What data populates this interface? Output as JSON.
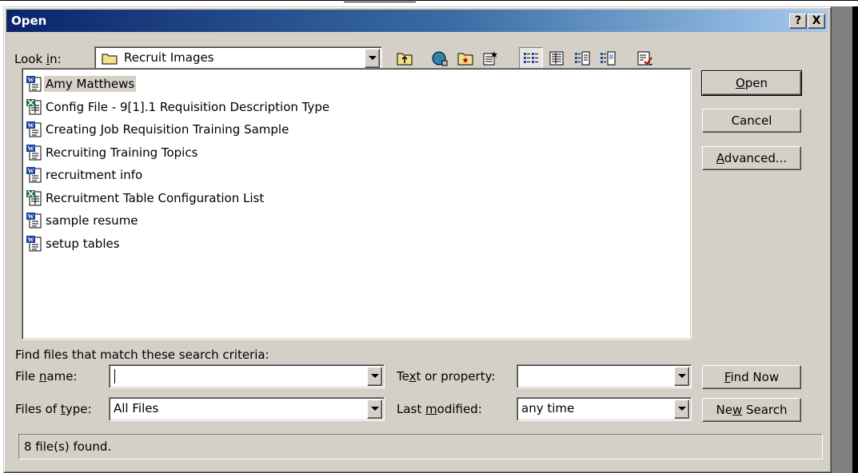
{
  "window": {
    "title": "Open",
    "help_button": "?",
    "close_button": "X"
  },
  "look_in": {
    "label_pre": "Look ",
    "label_key": "i",
    "label_post": "n:",
    "value": "Recruit Images"
  },
  "toolbar": {
    "icons": [
      "up-folder-icon",
      "search-web-icon",
      "new-folder-icon",
      "favorites-icon",
      "list-view-icon",
      "details-view-icon",
      "properties-view-icon",
      "preview-view-icon",
      "commands-icon"
    ]
  },
  "files": [
    {
      "name": "Amy Matthews",
      "type": "word-document-icon",
      "selected": true
    },
    {
      "name": "Config File - 9[1].1 Requisition Description Type",
      "type": "spreadsheet-document-icon",
      "selected": false
    },
    {
      "name": "Creating Job Requisition Training Sample",
      "type": "word-document-icon",
      "selected": false
    },
    {
      "name": "Recruiting Training Topics",
      "type": "word-document-icon",
      "selected": false
    },
    {
      "name": "recruitment info",
      "type": "word-document-icon",
      "selected": false
    },
    {
      "name": "Recruitment Table Configuration List",
      "type": "spreadsheet-document-icon",
      "selected": false
    },
    {
      "name": "sample resume",
      "type": "word-document-icon",
      "selected": false
    },
    {
      "name": "setup tables",
      "type": "word-document-icon",
      "selected": false
    }
  ],
  "buttons": {
    "open": {
      "key": "O",
      "rest": "pen"
    },
    "cancel": "Cancel",
    "advanced": {
      "key": "A",
      "rest": "dvanced..."
    },
    "find_now": {
      "key": "F",
      "rest": "ind Now"
    },
    "new_search": {
      "pre": "Ne",
      "key": "w",
      "rest": " Search"
    }
  },
  "search": {
    "heading": "Find files that match these search criteria:",
    "file_name": {
      "pre": "File ",
      "key": "n",
      "post": "ame:",
      "value": ""
    },
    "files_of_type": {
      "pre": "Files of ",
      "key": "t",
      "post": "ype:",
      "value": "All Files"
    },
    "text_property": {
      "pre": "Te",
      "key": "x",
      "post": "t or property:",
      "value": ""
    },
    "last_modified": {
      "pre": "Last ",
      "key": "m",
      "post": "odified:",
      "value": "any time"
    }
  },
  "status": "8 file(s) found.",
  "colors": {
    "dialog_face": "#d4d0c8",
    "title_start": "#0a246a",
    "title_end": "#a6caf0",
    "selection": "#d4d0c8"
  }
}
